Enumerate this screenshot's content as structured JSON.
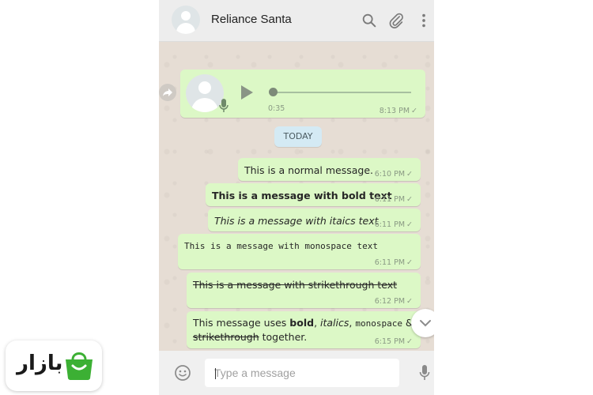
{
  "header": {
    "contact_name": "Reliance Santa",
    "icons": [
      "search-icon",
      "attach-icon",
      "menu-icon"
    ]
  },
  "voice_message": {
    "duration": "0:35",
    "time": "8:13 PM",
    "status": "sent",
    "icons": [
      "forward-icon",
      "avatar",
      "play-icon",
      "mic-icon"
    ]
  },
  "date_divider": "TODAY",
  "messages": [
    {
      "text": "This is a normal message.",
      "time": "6:10 PM",
      "style": "normal"
    },
    {
      "text": "This is a message with bold text",
      "time": "6:11 PM",
      "style": "bold"
    },
    {
      "text": "This is a message with itaics text",
      "time": "6:11 PM",
      "style": "italic"
    },
    {
      "text": "This is a message with monospace text",
      "time": "6:11 PM",
      "style": "monospace"
    },
    {
      "text": "This is a message with strikethrough text",
      "time": "6:12 PM",
      "style": "strikethrough"
    },
    {
      "parts": {
        "p1": "This message uses ",
        "bold": "bold",
        "p2": ", ",
        "italic": "italics",
        "p3": ", ",
        "mono": "monospace",
        "p4": " &",
        "strike": "strikethrough",
        "p5": " together."
      },
      "time": "6:15 PM",
      "style": "mixed"
    }
  ],
  "tick": "✓",
  "footer": {
    "placeholder": "Type a message",
    "icons": [
      "emoji-icon",
      "mic-icon"
    ]
  },
  "logo": {
    "text": "بازار",
    "icon": "shopping-bag-icon",
    "brand_color": "#3cb034"
  },
  "colors": {
    "bubble": "#dcf8c6",
    "header": "#ededed",
    "date_divider": "#d4eaf4"
  }
}
